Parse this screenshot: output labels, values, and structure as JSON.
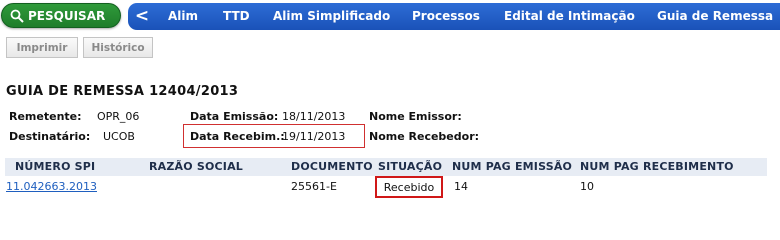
{
  "nav": {
    "search_label": "PESQUISAR",
    "back_symbol": "<",
    "items": [
      "Alim",
      "TTD",
      "Alim Simplificado",
      "Processos",
      "Edital de Intimação",
      "Guia de Remessa"
    ]
  },
  "toolbar": {
    "print_label": "Imprimir",
    "history_label": "Histórico"
  },
  "page": {
    "title": "GUIA DE REMESSA 12404/2013"
  },
  "details": {
    "remetente_label": "Remetente:",
    "remetente_value": "OPR_06",
    "destinatario_label": "Destinatário:",
    "destinatario_value": "UCOB",
    "data_emissao_label": "Data Emissão:",
    "data_emissao_value": "18/11/2013",
    "data_recebim_label": "Data Recebim.:",
    "data_recebim_value": "19/11/2013",
    "nome_emissor_label": "Nome Emissor:",
    "nome_recebedor_label": "Nome Recebedor:"
  },
  "table": {
    "headers": [
      "NÚMERO SPI",
      "RAZÃO SOCIAL",
      "DOCUMENTO",
      "SITUAÇÃO",
      "NUM PAG EMISSÃO",
      "NUM PAG RECEBIMENTO"
    ],
    "rows": [
      {
        "numero_spi": "11.042663.2013",
        "razao_social": "",
        "documento": "25561-E",
        "situacao": "Recebido",
        "num_pag_emissao": "14",
        "num_pag_recebimento": "10"
      }
    ]
  },
  "colors": {
    "nav_blue": "#1f5ec7",
    "search_green": "#23842f",
    "highlight_red": "#d01818",
    "link_blue": "#1f5fbf"
  }
}
